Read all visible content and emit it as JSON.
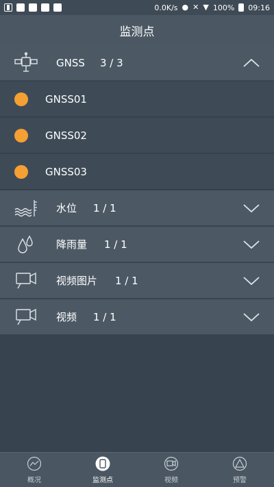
{
  "statusbar": {
    "speed": "0.0K/s",
    "battery": "100%",
    "time": "09:16"
  },
  "header": {
    "title": "监测点"
  },
  "groups": [
    {
      "label": "GNSS",
      "count": "3 / 3",
      "icon": "satellite-icon",
      "expanded": true,
      "items": [
        {
          "label": "GNSS01"
        },
        {
          "label": "GNSS02"
        },
        {
          "label": "GNSS03"
        }
      ]
    },
    {
      "label": "水位",
      "count": "1 / 1",
      "icon": "water-level-icon",
      "expanded": false
    },
    {
      "label": "降雨量",
      "count": "1 / 1",
      "icon": "rain-drops-icon",
      "expanded": false
    },
    {
      "label": "视频图片",
      "count": "1 / 1",
      "icon": "video-image-icon",
      "expanded": false
    },
    {
      "label": "视频",
      "count": "1 / 1",
      "icon": "video-icon",
      "expanded": false
    }
  ],
  "colors": {
    "dot": "#f5a033",
    "header": "#4b5864",
    "row": "#4c5965",
    "subrow": "#3e4b56",
    "background": "#37444f"
  },
  "tabs": [
    {
      "label": "概况",
      "icon": "overview-icon"
    },
    {
      "label": "监测点",
      "icon": "monitor-point-icon",
      "active": true
    },
    {
      "label": "视频",
      "icon": "video-tab-icon"
    },
    {
      "label": "预警",
      "icon": "warning-icon"
    }
  ]
}
